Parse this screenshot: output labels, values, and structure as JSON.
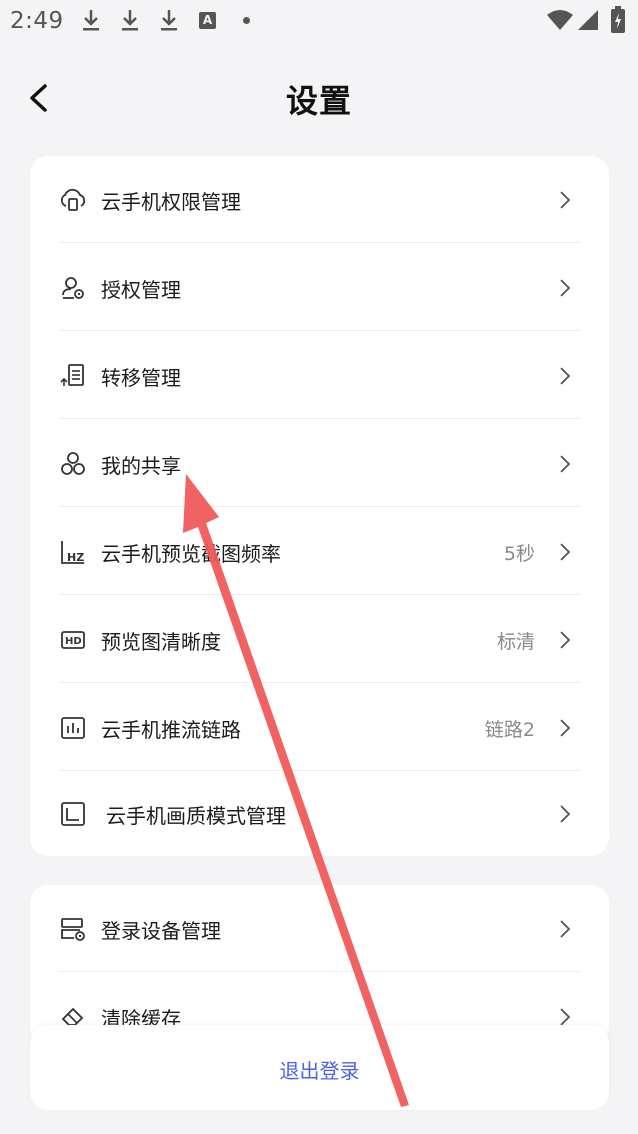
{
  "status_bar": {
    "time": "2:49",
    "notification_letter": "A"
  },
  "header": {
    "title": "设置"
  },
  "group1": [
    {
      "label": "云手机权限管理",
      "value": "",
      "icon": "cloud-phone-icon"
    },
    {
      "label": "授权管理",
      "value": "",
      "icon": "user-authorize-icon"
    },
    {
      "label": "转移管理",
      "value": "",
      "icon": "transfer-icon"
    },
    {
      "label": "我的共享",
      "value": "",
      "icon": "share-icon"
    },
    {
      "label": "云手机预览截图频率",
      "value": "5秒",
      "icon": "hz-icon"
    },
    {
      "label": "预览图清晰度",
      "value": "标清",
      "icon": "hd-icon"
    },
    {
      "label": "云手机推流链路",
      "value": "链路2",
      "icon": "chart-icon"
    },
    {
      "label": "云手机画质模式管理",
      "value": "",
      "icon": "quality-icon"
    }
  ],
  "group2": [
    {
      "label": "登录设备管理",
      "value": "",
      "icon": "device-icon"
    },
    {
      "label": "清除缓存",
      "value": "",
      "icon": "eraser-icon"
    }
  ],
  "logout": {
    "label": "退出登录"
  },
  "colors": {
    "accent": "#4a63e8",
    "annotation_arrow": "#f05a5a",
    "background": "#f4f4f6"
  }
}
